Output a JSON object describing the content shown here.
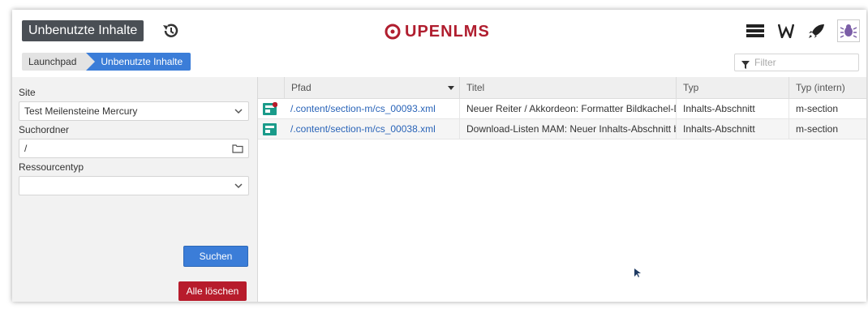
{
  "header": {
    "title": "Unbenutzte Inhalte",
    "logo_text": "UPENLMS",
    "colors": {
      "brand": "#b01e2f",
      "accent": "#3b7dd8",
      "danger": "#b71c2c"
    },
    "icons": [
      "history-icon",
      "menu-icon",
      "wiki-icon",
      "rocket-icon",
      "bug-icon"
    ]
  },
  "breadcrumb": {
    "items": [
      "Launchpad",
      "Unbenutzte Inhalte"
    ]
  },
  "filter": {
    "placeholder": "Filter"
  },
  "form": {
    "site_label": "Site",
    "site_value": "Test Meilensteine Mercury",
    "folder_label": "Suchordner",
    "folder_value": "/",
    "type_label": "Ressourcentyp",
    "type_value": "",
    "search_button": "Suchen",
    "clear_button": "Alle löschen"
  },
  "table": {
    "columns": [
      "Pfad",
      "Titel",
      "Typ",
      "Typ (intern)"
    ],
    "rows": [
      {
        "path": "/.content/section-m/cs_00093.xml",
        "title": "Neuer Reiter / Akkordeon: Formatter Bildkachel-Dar",
        "type": "Inhalts-Abschnitt",
        "type_internal": "m-section",
        "flag": true
      },
      {
        "path": "/.content/section-m/cs_00038.xml",
        "title": "Download-Listen MAM: Neuer Inhalts-Abschnitt bra",
        "type": "Inhalts-Abschnitt",
        "type_internal": "m-section",
        "flag": false
      }
    ]
  }
}
